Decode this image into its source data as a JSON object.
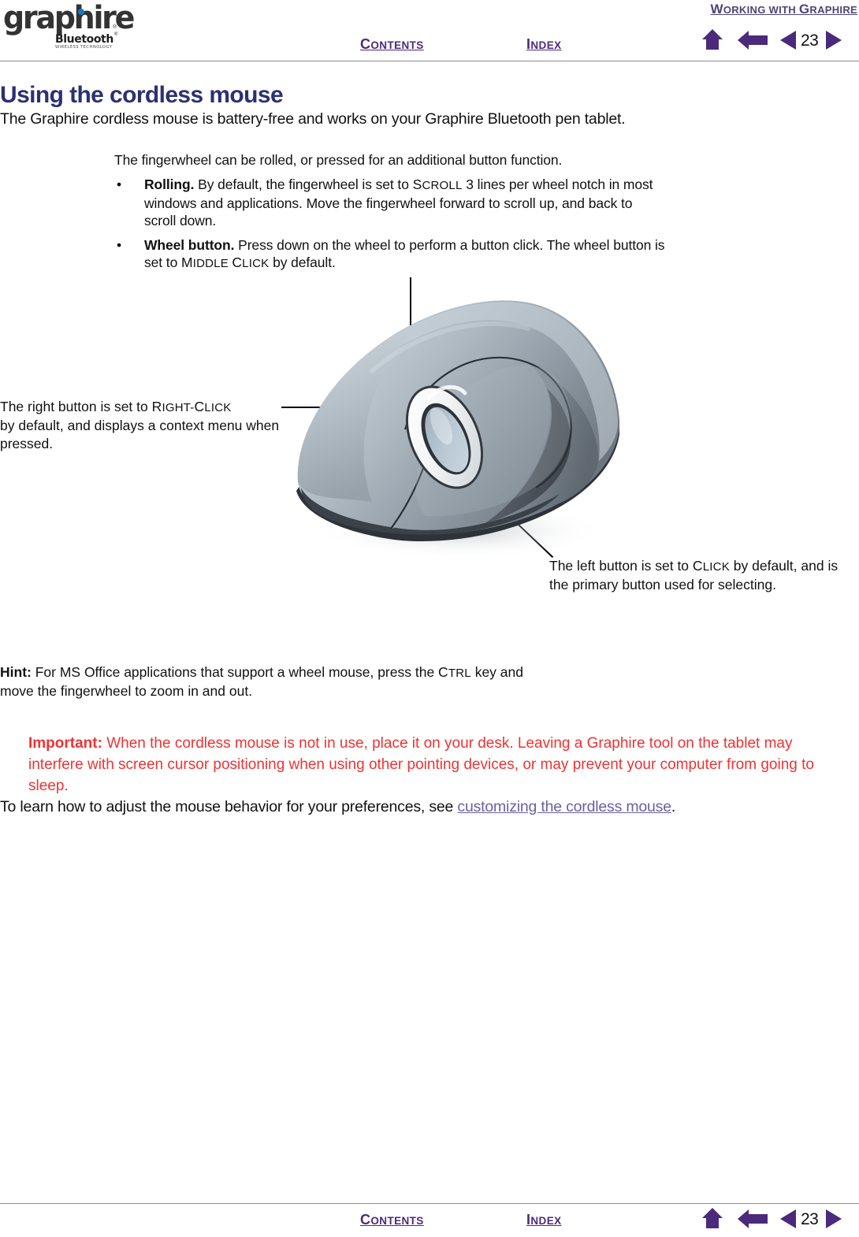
{
  "logo": {
    "wordmark": "graphire",
    "registered": "®",
    "bluetooth": "Bluetooth",
    "bluetooth_registered": "®",
    "tagline": "WIRELESS TECHNOLOGY",
    "dot_color": "#1779c4"
  },
  "header": {
    "breadcrumb_cap": "W",
    "breadcrumb_rest": "ORKING WITH ",
    "breadcrumb": "WORKING WITH GRAPHIRE",
    "contents_cap": "C",
    "contents_rest": "ONTENTS",
    "contents": "CONTENTS",
    "index_cap": "I",
    "index_rest": "NDEX",
    "index": "INDEX",
    "page_number": "23",
    "nav_color": "#4b2a7b",
    "breadcrumb_color": "#4f4477",
    "icons": [
      "home-icon",
      "back-arrow-icon",
      "previous-page-icon",
      "next-page-icon"
    ]
  },
  "footer": {
    "contents_cap": "C",
    "contents_rest": "ONTENTS",
    "contents": "CONTENTS",
    "index_cap": "I",
    "index_rest": "NDEX",
    "index": "INDEX",
    "page_number": "23"
  },
  "main": {
    "title": "Using the cordless mouse",
    "title_color": "#2b3171",
    "intro": "The Graphire cordless mouse is battery-free and works on your Graphire Bluetooth pen tablet.",
    "wheel": {
      "lead": "The fingerwheel can be rolled, or pressed for an additional button function.",
      "bullet_glyph": "•",
      "items": [
        {
          "term": "Rolling.",
          "text_before": "  By default, the fingerwheel is set to ",
          "smallcap_first": "S",
          "smallcap_rest": "CROLL",
          "smallcap_full": "SCROLL",
          "text_after": " 3 lines per wheel notch in most windows and applications.  Move the fingerwheel forward to scroll up, and back to scroll down."
        },
        {
          "term": "Wheel button.",
          "text_before": "  Press down on the wheel to perform a button click. The wheel button is set to ",
          "smallcap_first": "M",
          "smallcap_rest": "IDDLE",
          "smallcap_first2": "C",
          "smallcap_rest2": "LICK",
          "smallcap_full": "MIDDLE CLICK",
          "text_after": " by default."
        }
      ]
    },
    "callouts": {
      "right_button": {
        "line1_before": "The right button is set to ",
        "sc_cap1": "R",
        "sc_rest1": "IGHT",
        "sc_dash": "-",
        "sc_cap2": "C",
        "sc_rest2": "LICK",
        "smallcap_full": "RIGHT-CLICK",
        "line2": "by default, and displays a context menu when pressed."
      },
      "left_button": {
        "line1_before": "The left button is set to ",
        "sc_cap1": "C",
        "sc_rest1": "LICK",
        "smallcap_full": "CLICK",
        "line1_after": " by default, and is the primary button used for selecting."
      }
    },
    "hint": {
      "label": "Hint:",
      "text_before": " For MS Office applications that support a wheel mouse, press the ",
      "sc_cap": "C",
      "sc_rest": "TRL",
      "smallcap_full": "CTRL",
      "text_after": " key and move the fingerwheel to zoom in and out."
    },
    "important": {
      "label": "Important:",
      "text": " When the cordless mouse is not in use, place it on your desk.  Leaving a Graphire tool on the tablet may interfere with screen cursor positioning when using other pointing devices, or may prevent your computer from going to sleep.",
      "color": "#ee3333"
    },
    "closing": {
      "text_before": "To learn how to adjust the mouse behavior for your preferences, see ",
      "link": "customizing the cordless mouse",
      "link_color": "#6c5fa3",
      "text_after": "."
    },
    "figure": {
      "name": "cordless-mouse-illustration",
      "alt": "Graphire cordless mouse shown from a three-quarter top view with fingerwheel, left button and right button"
    }
  }
}
